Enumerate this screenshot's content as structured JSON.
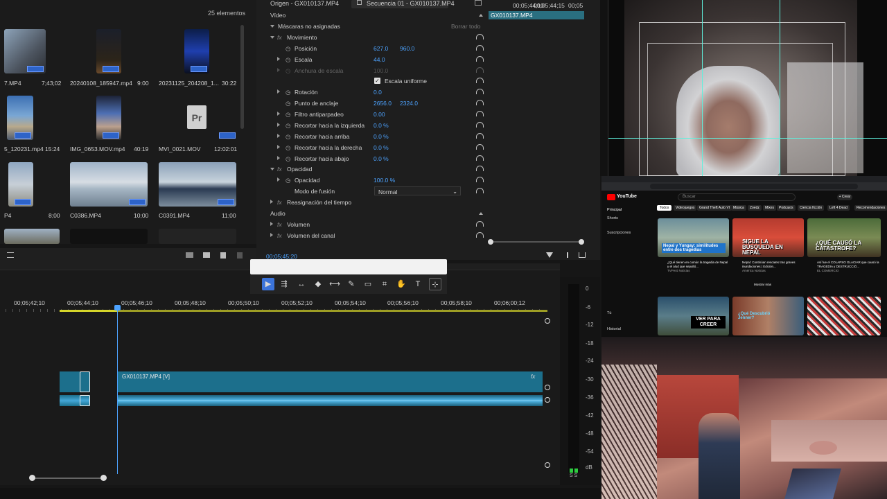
{
  "project": {
    "count": "25 elementos",
    "items": [
      {
        "name": "7.MP4",
        "dur": "7;43;02"
      },
      {
        "name": "20240108_185947.mp4",
        "dur": "9:00"
      },
      {
        "name": "20231125_204208_1...",
        "dur": "30:22"
      },
      {
        "name": "5_120231.mp4",
        "dur": "15:24"
      },
      {
        "name": "IMG_0653.MOV.mp4",
        "dur": "40:19"
      },
      {
        "name": "MVI_0021.MOV",
        "dur": "12:02:01"
      },
      {
        "name": "P4",
        "dur": "8;00"
      },
      {
        "name": "C0386.MP4",
        "dur": "10;00"
      },
      {
        "name": "C0391.MP4",
        "dur": "11;00"
      }
    ],
    "pr_icon_label": "Pr"
  },
  "effects": {
    "tab_source": "Origen - GX010137.MP4",
    "tab_sequence": "Secuencia 01 - GX010137.MP4",
    "ruler": [
      "00;05;44;10",
      "00;05;44;15",
      "00;05"
    ],
    "clip_label": "GX010137.MP4",
    "section_video": "Vídeo",
    "masks": "Máscaras no asignadas",
    "clear_all": "Borrar todo",
    "movement": "Movimiento",
    "position_label": "Posición",
    "position_x": "627.0",
    "position_y": "960.0",
    "scale_label": "Escala",
    "scale_value": "44.0",
    "scale_width_label": "Anchura de escala",
    "scale_width_value": "100.0",
    "uniform_scale": "Escala uniforme",
    "rotation_label": "Rotación",
    "rotation_value": "0.0",
    "anchor_label": "Punto de anclaje",
    "anchor_x": "2656.0",
    "anchor_y": "2324.0",
    "antiflicker_label": "Filtro antiparpadeo",
    "antiflicker_value": "0.00",
    "crop_left_label": "Recortar hacia la izquierda",
    "crop_left_value": "0.0 %",
    "crop_top_label": "Recortar hacia arriba",
    "crop_top_value": "0.0 %",
    "crop_right_label": "Recortar hacia la derecha",
    "crop_right_value": "0.0 %",
    "crop_bottom_label": "Recortar hacia abajo",
    "crop_bottom_value": "0.0 %",
    "opacity_section": "Opacidad",
    "opacity_label": "Opacidad",
    "opacity_value": "100.0 %",
    "blend_label": "Modo de fusión",
    "blend_value": "Normal",
    "time_remap": "Reasignación del tiempo",
    "section_audio": "Audio",
    "volume": "Volumen",
    "channel_volume": "Volumen del canal",
    "current_time": "00;05;45;20"
  },
  "timeline": {
    "ruler": [
      "00;05;42;10",
      "00;05;44;10",
      "00;05;46;10",
      "00;05;48;10",
      "00;05;50;10",
      "00;05;52;10",
      "00;05;54;10",
      "00;05;56;10",
      "00;05;58;10",
      "00;06;00;12"
    ],
    "clip_label": "GX010137.MP4 [V]",
    "fx_badge": "fx"
  },
  "meter": {
    "scale": [
      "0",
      "-6",
      "-12",
      "-18",
      "-24",
      "-30",
      "-36",
      "-42",
      "-48",
      "-54",
      "dB"
    ],
    "footer": "S S"
  },
  "youtube": {
    "brand": "YouTube",
    "search_placeholder": "Buscar",
    "create": "+ Crear",
    "chips": [
      "Todos",
      "Videojuegos",
      "Grand Theft Auto VI",
      "Música",
      "Zoedz",
      "Mixes",
      "Podcasts",
      "Ciencia ficción",
      "Left 4 Dead",
      "Recomendaciones"
    ],
    "sidebar": [
      "Principal",
      "Shorts",
      "Suscripciones",
      "Tú",
      "Historial"
    ],
    "videos": [
      {
        "title": "¿Qué tienen en común la tragedia de Nepal y el alud que sepultó...",
        "meta": "TVPerú Noticias",
        "overlay": "Nepal y Yungay: similitudes entre dos tragedias"
      },
      {
        "title": "Nepal: Continúan rescates tras graves inundaciones | Edición...",
        "meta": "América Noticias",
        "overlay": "SIGUE LA BÚSQUEDA EN NEPAL"
      },
      {
        "title": "Así fue el COLAPSO GLACIAR que causó la TRAGEDIA y DESTRUCCIÓ...",
        "meta": "EL COMERCIO",
        "overlay": "¿QUÉ CAUSÓ LA CATASTROFE?"
      }
    ],
    "row2_overlay": "VER PARA CREER",
    "row2_overlay_b": "¿Qué Descubrió Jenner?",
    "more": "Mostrar más"
  }
}
